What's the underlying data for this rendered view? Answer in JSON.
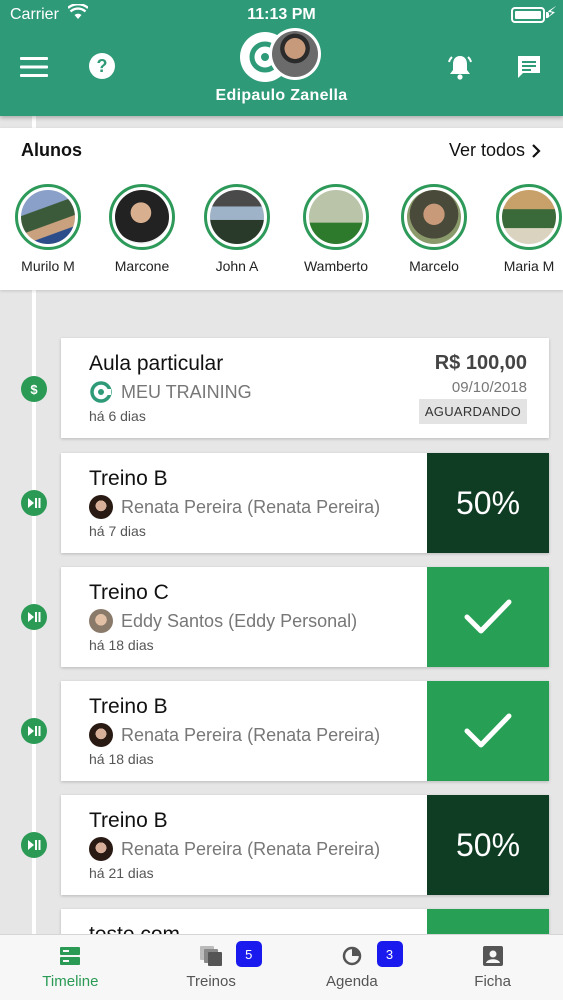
{
  "status_bar": {
    "carrier": "Carrier",
    "time": "11:13 PM"
  },
  "header": {
    "user_name": "Edipaulo Zanella"
  },
  "students": {
    "title": "Alunos",
    "see_all": "Ver todos",
    "items": [
      {
        "name": "Murilo M"
      },
      {
        "name": "Marcone"
      },
      {
        "name": "John A"
      },
      {
        "name": "Wamberto"
      },
      {
        "name": "Marcelo"
      },
      {
        "name": "Maria M"
      }
    ]
  },
  "timeline": {
    "payment": {
      "title": "Aula particular",
      "subtitle": "MEU TRAINING",
      "ago": "há 6 dias",
      "price": "R$ 100,00",
      "date": "09/10/2018",
      "status": "AGUARDANDO"
    },
    "workouts": [
      {
        "title": "Treino B",
        "trainer": "Renata Pereira (Renata Pereira)",
        "ago": "há 7 dias",
        "result": "50%"
      },
      {
        "title": "Treino C",
        "trainer": "Eddy Santos (Eddy Personal)",
        "ago": "há 18 dias",
        "result": ""
      },
      {
        "title": "Treino B",
        "trainer": "Renata Pereira (Renata Pereira)",
        "ago": "há 18 dias",
        "result": ""
      },
      {
        "title": "Treino B",
        "trainer": "Renata Pereira (Renata Pereira)",
        "ago": "há 21 dias",
        "result": "50%"
      }
    ],
    "partial_card_title": "teste.com"
  },
  "tabbar": {
    "tabs": [
      {
        "label": "Timeline",
        "badge": ""
      },
      {
        "label": "Treinos",
        "badge": "5"
      },
      {
        "label": "Agenda",
        "badge": "3"
      },
      {
        "label": "Ficha",
        "badge": ""
      }
    ]
  },
  "colors": {
    "header": "#2e9a78",
    "accent": "#2a9a55",
    "dark_result": "#0f3d23",
    "badge": "#1a1aee"
  }
}
